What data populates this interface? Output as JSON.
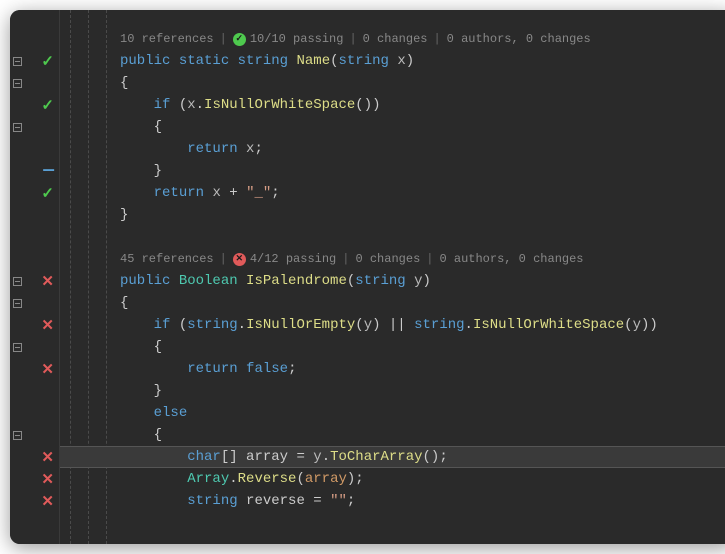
{
  "codelens1": {
    "refs": "10 references",
    "tests": "10/10 passing",
    "changes": "0 changes",
    "authors": "0 authors, 0 changes"
  },
  "codelens2": {
    "refs": "45 references",
    "tests": "4/12 passing",
    "changes": "0 changes",
    "authors": "0 authors, 0 changes"
  },
  "kw": {
    "public": "public",
    "static": "static",
    "string": "string",
    "if": "if",
    "return": "return",
    "else": "else",
    "false": "false",
    "char": "char"
  },
  "type": {
    "Boolean": "Boolean",
    "Array": "Array"
  },
  "fn": {
    "Name": "Name",
    "IsNullOrWhiteSpace": "IsNullOrWhiteSpace",
    "IsPalendrome": "IsPalendrome",
    "IsNullOrEmpty": "IsNullOrEmpty",
    "ToCharArray": "ToCharArray",
    "Reverse": "Reverse"
  },
  "id": {
    "x": "x",
    "y": "y",
    "array": "array",
    "reverse": "reverse"
  },
  "str": {
    "underscore": "\"_\"",
    "empty": "\"\""
  },
  "sym": {
    "lparen": "(",
    "rparen": ")",
    "lbrace": "{",
    "rbrace": "}",
    "lbracket": "[",
    "rbracket": "]",
    "semi": ";",
    "dot": ".",
    "plus": " + ",
    "or": " || ",
    "eq": " = ",
    "sep": " | "
  }
}
